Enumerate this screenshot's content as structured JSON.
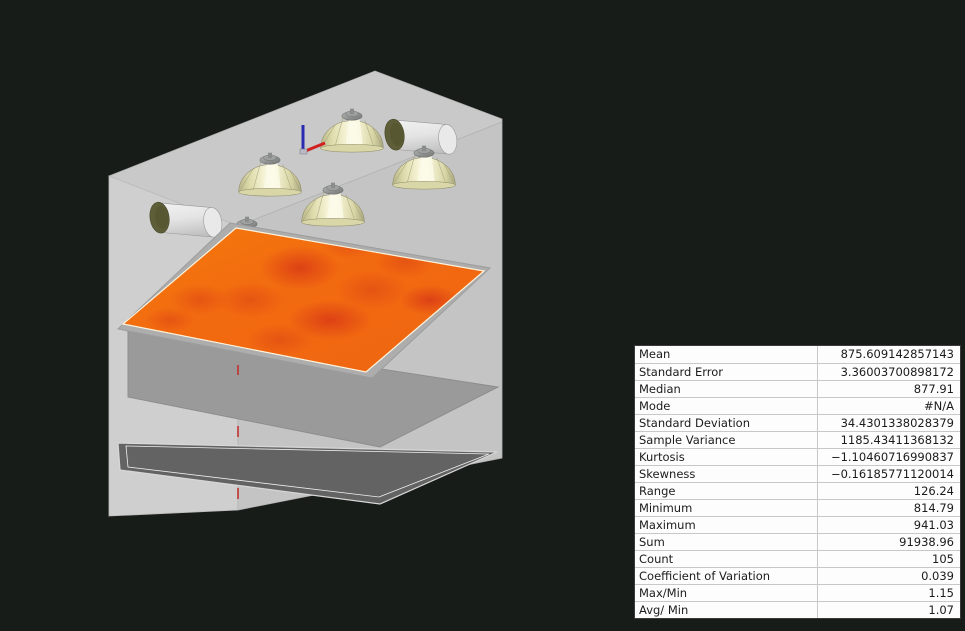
{
  "scene": {
    "name": "3d-lighting-simulation-view",
    "background_color": "#171c19",
    "wall_color": "#c9c9c9",
    "ceiling_color": "#c6c6c6",
    "mid_plane_color": "#9a9a9a",
    "floor_plane_color": "#636363",
    "heatmap_color": "#f4720a",
    "heatmap_hot_color": "#d93a16",
    "luminaire_shade_color": "#e8e6b4",
    "luminaire_highlight_color": "#fbfbe2",
    "luminaire_cap_color": "#8e9090",
    "cylinder_body_color": "#e6e6e6",
    "cylinder_interior_color": "#5e5f38",
    "axis_gizmo": {
      "z_axis_color": "#2a2ab0",
      "x_axis_color": "#d02020",
      "label": "axis-gizmo"
    },
    "luminaires": [
      {
        "type": "dome",
        "label": "luminaire-dome-1"
      },
      {
        "type": "dome",
        "label": "luminaire-dome-2"
      },
      {
        "type": "dome",
        "label": "luminaire-dome-3"
      },
      {
        "type": "dome",
        "label": "luminaire-dome-4"
      },
      {
        "type": "dome",
        "label": "luminaire-dome-5"
      },
      {
        "type": "cylinder",
        "label": "luminaire-cylinder-1"
      },
      {
        "type": "cylinder",
        "label": "luminaire-cylinder-2"
      }
    ],
    "planes": [
      {
        "label": "calculation-surface-heatmap"
      },
      {
        "label": "working-plane"
      },
      {
        "label": "floor-plane"
      }
    ]
  },
  "stats": {
    "rows": [
      {
        "label": "Mean",
        "value": "875.609142857143"
      },
      {
        "label": "Standard Error",
        "value": "3.36003700898172"
      },
      {
        "label": "Median",
        "value": "877.91"
      },
      {
        "label": "Mode",
        "value": "#N/A"
      },
      {
        "label": "Standard Deviation",
        "value": "34.4301338028379"
      },
      {
        "label": "Sample Variance",
        "value": "1185.43411368132"
      },
      {
        "label": "Kurtosis",
        "value": "−1.10460716990837"
      },
      {
        "label": "Skewness",
        "value": "−0.16185771120014"
      },
      {
        "label": "Range",
        "value": "126.24"
      },
      {
        "label": "Minimum",
        "value": "814.79"
      },
      {
        "label": "Maximum",
        "value": "941.03"
      },
      {
        "label": "Sum",
        "value": "91938.96"
      },
      {
        "label": "Count",
        "value": "105"
      },
      {
        "label": "Coefficient of Variation",
        "value": "0.039"
      },
      {
        "label": "Max/Min",
        "value": "1.15"
      },
      {
        "label": "Avg/ Min",
        "value": "1.07"
      }
    ]
  }
}
